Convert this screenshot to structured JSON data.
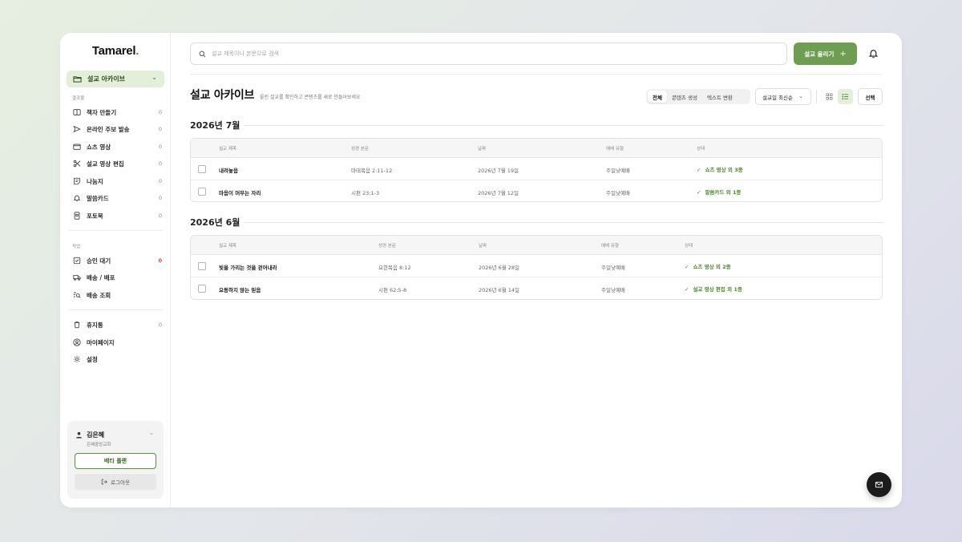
{
  "brand": {
    "logo_text": "Tamarel",
    "logo_dot": "."
  },
  "sidebar": {
    "active_item": {
      "label": "설교 아카이브",
      "icon": "folder-open-icon"
    },
    "section_result": "결과물",
    "result_items": [
      {
        "label": "책자 만들기",
        "count": "0",
        "icon": "book-icon"
      },
      {
        "label": "온라인 주보 발송",
        "count": "0",
        "icon": "send-icon"
      },
      {
        "label": "쇼츠 영상",
        "count": "0",
        "icon": "video-icon"
      },
      {
        "label": "설교 영상 편집",
        "count": "0",
        "icon": "scissors-icon"
      },
      {
        "label": "나눔지",
        "count": "0",
        "icon": "note-icon"
      },
      {
        "label": "말씀카드",
        "count": "0",
        "icon": "bell-icon"
      },
      {
        "label": "포토북",
        "count": "0",
        "icon": "photobook-icon"
      }
    ],
    "section_work": "작업",
    "work_items": [
      {
        "label": "승인 대기",
        "count": "0",
        "icon": "check-square-icon",
        "count_color": "#e0452b"
      },
      {
        "label": "배송 / 배포",
        "icon": "truck-icon"
      },
      {
        "label": "배송 조회",
        "icon": "search-list-icon"
      }
    ],
    "bottom_items": [
      {
        "label": "휴지통",
        "count": "0",
        "icon": "trash-icon"
      },
      {
        "label": "마이페이지",
        "icon": "user-circle-icon"
      },
      {
        "label": "설정",
        "icon": "gear-icon"
      }
    ],
    "user": {
      "name": "김은혜",
      "church": "은혜중앙교회",
      "plan_label": "베타 플랜",
      "logout_label": "로그아웃"
    }
  },
  "header": {
    "search_placeholder": "설교 제목이나 본문으로 검색",
    "upload_label": "설교 올리기",
    "upload_plus": "+",
    "accent_color": "#6f9d52"
  },
  "page": {
    "title": "설교 아카이브",
    "subtitle": "올린 설교를 확인하고 콘텐츠를 새로 만들어보세요",
    "filters": [
      "전체",
      "콘텐츠 생성",
      "텍스트 변환"
    ],
    "active_filter": "전체",
    "sort_label": "설교일 최신순",
    "view_mode": "list",
    "select_label": "선택"
  },
  "groups": [
    {
      "month": "2026년 7월",
      "columns": [
        "설교 제목",
        "성경 본문",
        "날짜",
        "예배 유형",
        "상태"
      ],
      "rows": [
        {
          "title": "내려놓음",
          "scripture": "마태복음 2:11-12",
          "date": "2026년 7월 19일",
          "service": "주일낮예배",
          "status": "쇼츠 영상 외 3종"
        },
        {
          "title": "마음이 머무는 자리",
          "scripture": "시편 23:1-3",
          "date": "2026년 7월 12일",
          "service": "주일낮예배",
          "status": "말씀카드 외 1종"
        }
      ]
    },
    {
      "month": "2026년 6월",
      "columns": [
        "설교 제목",
        "성경 본문",
        "날짜",
        "예배 유형",
        "상태"
      ],
      "rows": [
        {
          "title": "빛을 가리는 것을 걷어내라",
          "scripture": "요한복음 8:12",
          "date": "2026년 6월 28일",
          "service": "주일낮예배",
          "status": "쇼츠 영상 외 2종"
        },
        {
          "title": "요동하지 않는 믿음",
          "scripture": "시편 62:5-8",
          "date": "2026년 6월 14일",
          "service": "주일낮예배",
          "status": "설교 영상 편집 외 1종"
        }
      ]
    }
  ],
  "status_check": "✓"
}
